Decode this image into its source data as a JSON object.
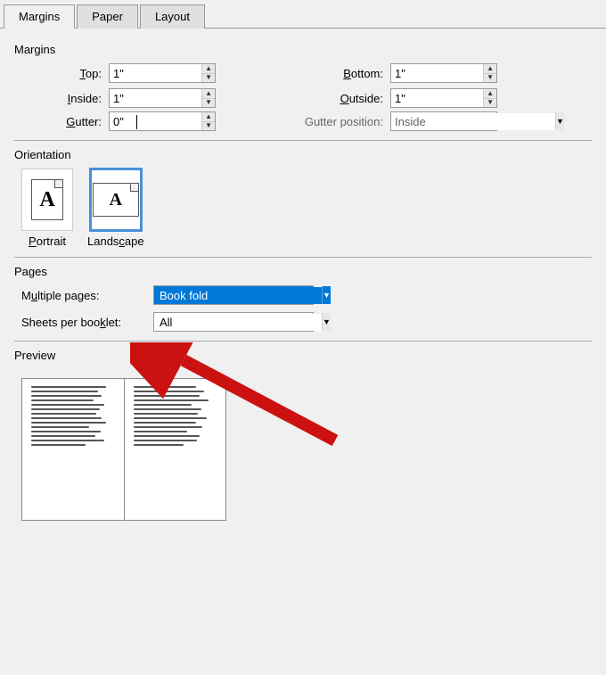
{
  "tabs": [
    {
      "id": "margins",
      "label": "Margins",
      "active": true
    },
    {
      "id": "paper",
      "label": "Paper",
      "active": false
    },
    {
      "id": "layout",
      "label": "Layout",
      "active": false
    }
  ],
  "margins_section": {
    "title": "Margins",
    "fields": {
      "top": {
        "label": "Top:",
        "underline": "T",
        "value": "1\""
      },
      "bottom": {
        "label": "Bottom:",
        "underline": "B",
        "value": "1\""
      },
      "inside": {
        "label": "Inside:",
        "underline": "I",
        "value": "1\""
      },
      "outside": {
        "label": "Outside:",
        "underline": "O",
        "value": "1\""
      },
      "gutter": {
        "label": "Gutter:",
        "underline": "G",
        "value": "0\""
      },
      "gutter_position": {
        "label": "Gutter position:",
        "value": "Inside"
      }
    }
  },
  "orientation_section": {
    "title": "Orientation",
    "options": [
      {
        "id": "portrait",
        "label": "Portrait",
        "underline": "P",
        "selected": false
      },
      {
        "id": "landscape",
        "label": "Landscape",
        "underline": "c",
        "selected": true
      }
    ]
  },
  "pages_section": {
    "title": "Pages",
    "multiple_pages": {
      "label": "Multiple pages:",
      "underline": "u",
      "value": "Book fold"
    },
    "sheets_per_booklet": {
      "label": "Sheets per booklet:",
      "underline": "k",
      "value": "All"
    }
  },
  "preview_section": {
    "title": "Preview"
  },
  "icons": {
    "spinner_up": "▲",
    "spinner_down": "▼",
    "dropdown_arrow": "▼"
  },
  "colors": {
    "selected_tab": "#0078d7",
    "accent_blue": "#0078d7",
    "arrow_red": "#cc0000"
  }
}
